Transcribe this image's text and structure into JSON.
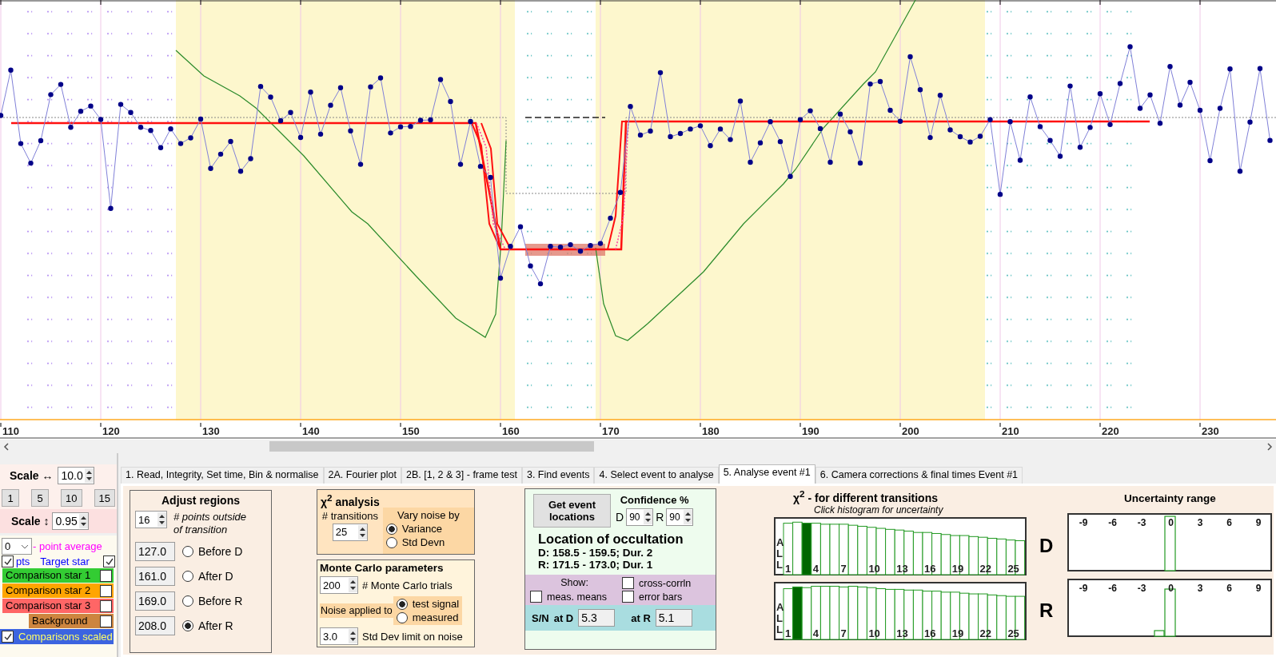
{
  "chart": {
    "x_labels": [
      "110",
      "120",
      "130",
      "140",
      "150",
      "160",
      "170",
      "180",
      "190",
      "200",
      "210",
      "220",
      "230"
    ]
  },
  "scale_panel": {
    "h_label": "Scale ↔",
    "h_value": "10.0",
    "zoom_buttons": [
      "1",
      "5",
      "10",
      "15"
    ],
    "v_label": "Scale ↕",
    "v_value": "0.95"
  },
  "display": {
    "average_value": "0",
    "average_label": "- point average",
    "points": {
      "label": "pts",
      "checked": true
    },
    "stars": [
      {
        "label": "Target star",
        "checked": true,
        "kind": "text",
        "color": "#0000ff"
      },
      {
        "label": "Comparison star 1",
        "checked": false,
        "kind": "band",
        "color": "#33cc33"
      },
      {
        "label": "Comparison star 2",
        "checked": false,
        "kind": "band",
        "color": "#ffa500"
      },
      {
        "label": "Comparison star 3",
        "checked": false,
        "kind": "band",
        "color": "#ff6666"
      },
      {
        "label": "Background",
        "checked": false,
        "kind": "short",
        "color": "#cd853f"
      }
    ],
    "scaled": {
      "label": "Comparisons scaled",
      "checked": true
    }
  },
  "tabs": [
    {
      "label": "1.  Read, Integrity, Set time, Bin & normalise",
      "selected": false
    },
    {
      "label": "2A. Fourier plot",
      "selected": false
    },
    {
      "label": "2B. [1, 2 & 3] - frame test",
      "selected": false
    },
    {
      "label": "3. Find events",
      "selected": false
    },
    {
      "label": "4. Select event to analyse",
      "selected": false
    },
    {
      "label": "5. Analyse event #1",
      "selected": true
    },
    {
      "label": "6. Camera corrections & final times Event #1",
      "selected": false
    }
  ],
  "adjust_regions": {
    "title": "Adjust regions",
    "points_outside": "16",
    "points_label": "# points outside of transition",
    "rows": [
      {
        "value": "127.0",
        "label": "Before D",
        "selected": false
      },
      {
        "value": "161.0",
        "label": "After D",
        "selected": false
      },
      {
        "value": "169.0",
        "label": "Before R",
        "selected": false
      },
      {
        "value": "208.0",
        "label": "After R",
        "selected": true
      }
    ]
  },
  "chi2": {
    "title": "χ$^{2}$ analysis",
    "transitions_label": "# transitions",
    "transitions": "25",
    "vary_label": "Vary noise by",
    "vary_options": [
      {
        "label": "Variance",
        "selected": true
      },
      {
        "label": "Std Devn",
        "selected": false
      }
    ]
  },
  "monte_carlo": {
    "title": "Monte Carlo parameters",
    "trials": "200",
    "trials_label": "# Monte Carlo trials",
    "noise_label": "Noise applied to",
    "noise_options": [
      {
        "label": "test signal",
        "selected": true
      },
      {
        "label": "measured",
        "selected": false
      }
    ],
    "limit": "3.0",
    "limit_label": "Std Dev limit on noise"
  },
  "event": {
    "button": "Get event locations",
    "confidence_label": "Confidence %",
    "d_label": "D",
    "d_conf": "90",
    "r_label": "R",
    "r_conf": "90",
    "location_title": "Location of occultation",
    "d_result": "D: 158.5 - 159.5; Dur. 2",
    "r_result": "R: 171.5 - 173.0; Dur. 1",
    "show_label": "Show:",
    "show_options": [
      {
        "label": "cross-corrln",
        "checked": false
      },
      {
        "label": "meas. means",
        "checked": false
      },
      {
        "label": "error bars",
        "checked": false
      }
    ],
    "sn_label": "S/N",
    "sn_d_label": "at D",
    "sn_d": "5.3",
    "sn_r_label": "at R",
    "sn_r": "5.1"
  },
  "transitions": {
    "title": "χ$^{2}$ -  for different transitions",
    "hint": "Click histogram for uncertainty",
    "histograms": [
      {
        "letter": "D",
        "side_label": "ALL",
        "x_labels": [
          "1",
          "4",
          "7",
          "10",
          "13",
          "16",
          "19",
          "22",
          "25"
        ]
      },
      {
        "letter": "R",
        "side_label": "ALL",
        "x_labels": [
          "1",
          "4",
          "7",
          "10",
          "13",
          "16",
          "19",
          "22",
          "25"
        ]
      }
    ]
  },
  "uncertainty": {
    "title": "Uncertainty range",
    "panels": [
      {
        "x_labels": [
          "-9",
          "-6",
          "-3",
          "0",
          "3",
          "6",
          "9"
        ]
      },
      {
        "x_labels": [
          "-9",
          "-6",
          "-3",
          "0",
          "3",
          "6",
          "9"
        ]
      }
    ]
  }
}
